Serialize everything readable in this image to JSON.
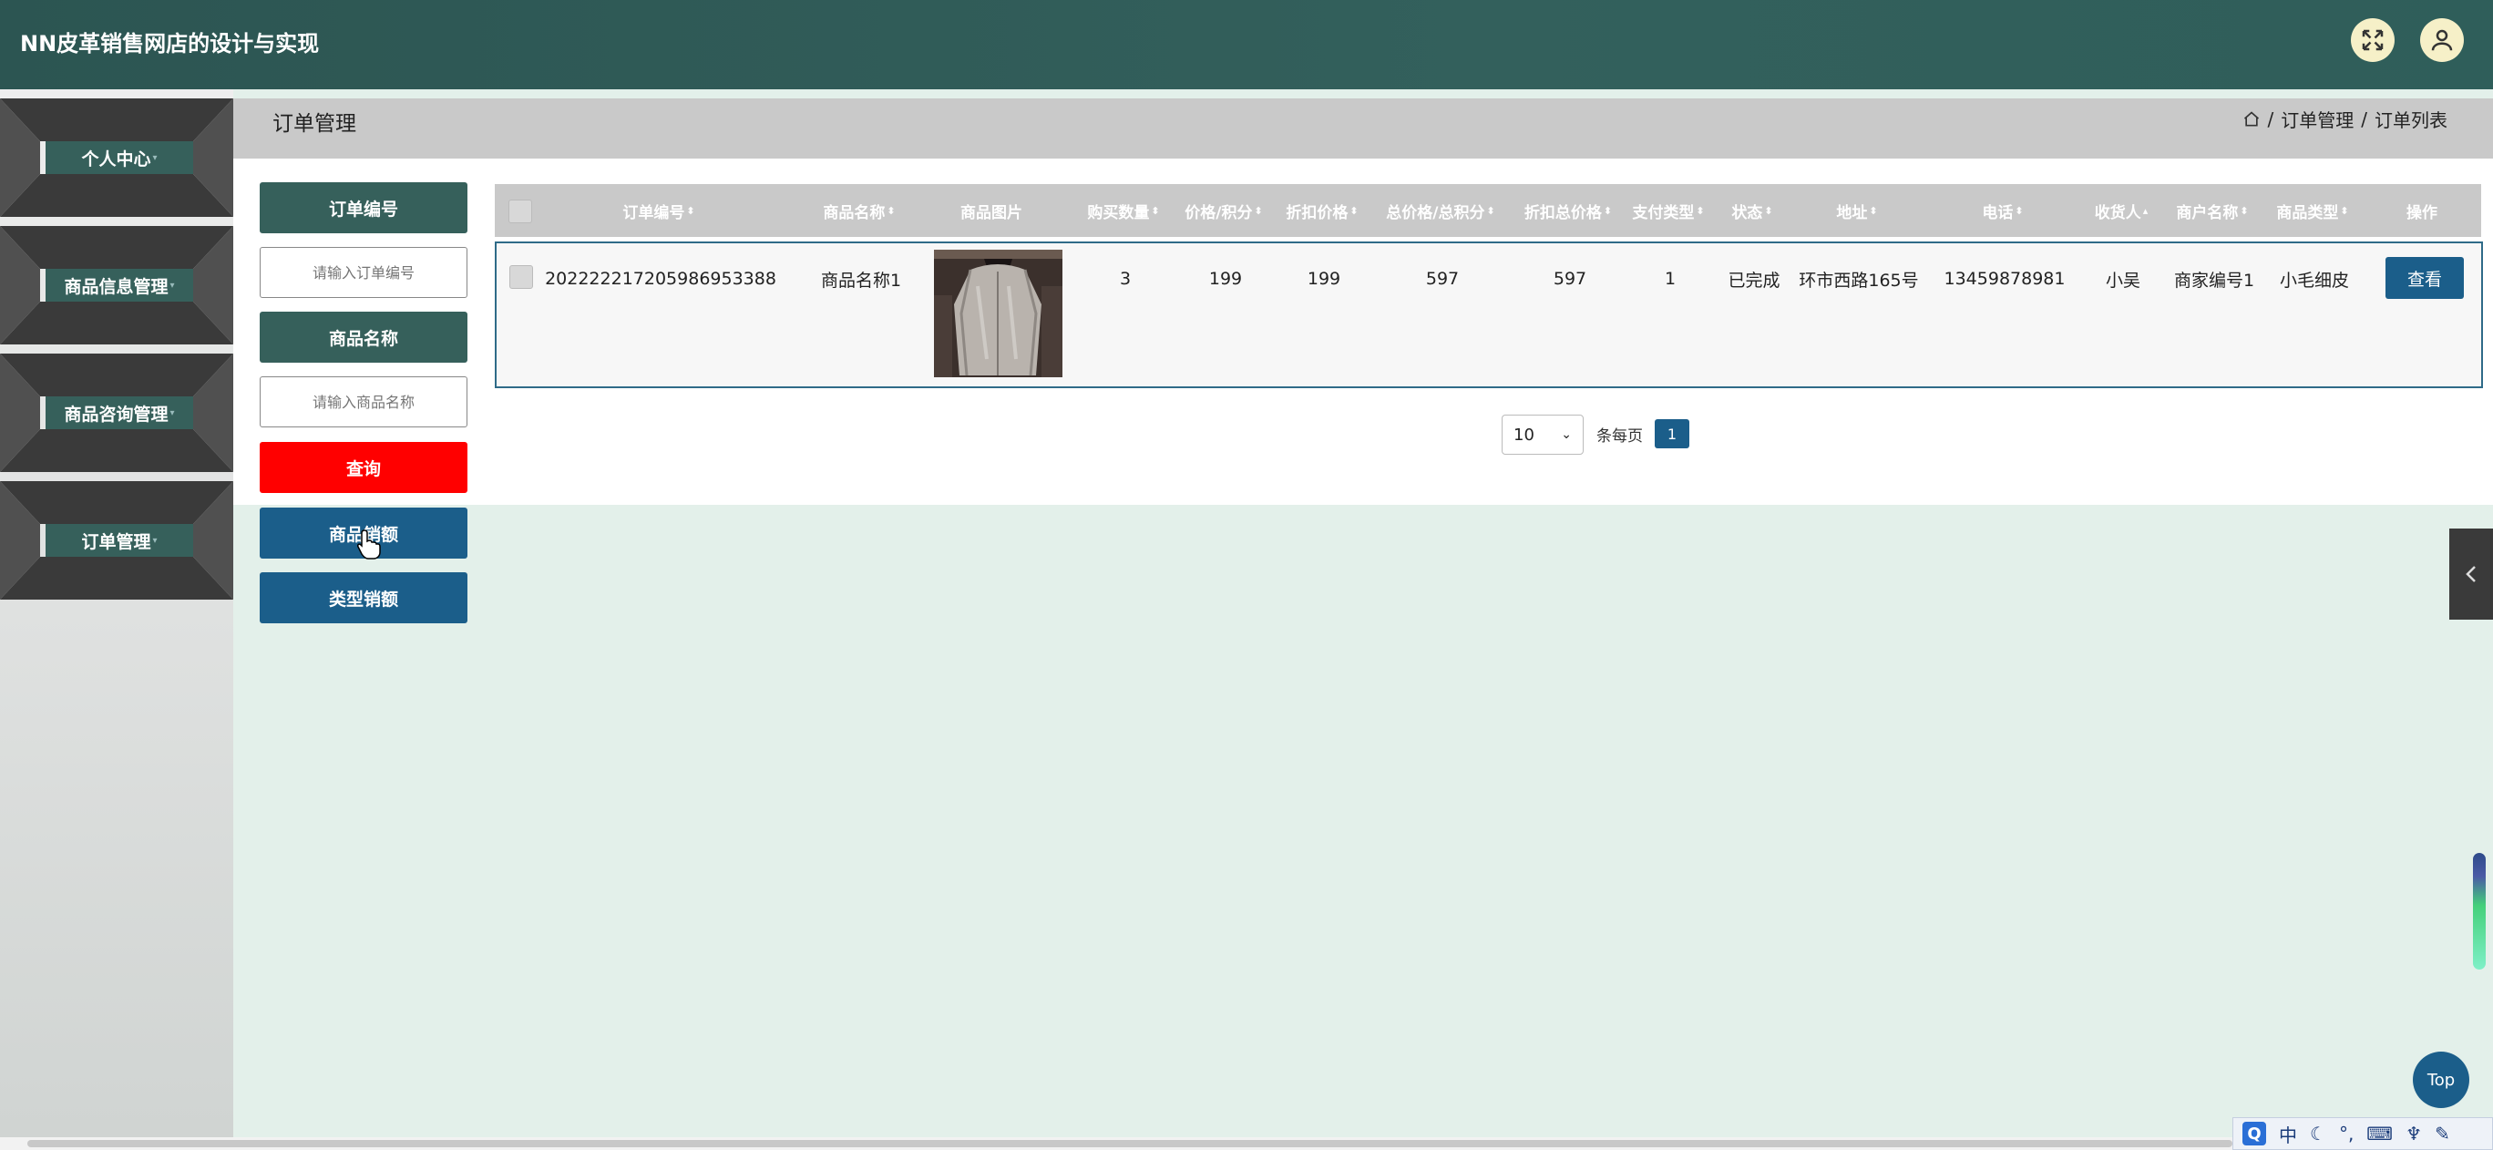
{
  "app": {
    "title": "NN皮革销售网店的设计与实现"
  },
  "sidebar": {
    "items": [
      {
        "label": "个人中心"
      },
      {
        "label": "商品信息管理"
      },
      {
        "label": "商品咨询管理"
      },
      {
        "label": "订单管理"
      }
    ]
  },
  "header": {
    "page_title": "订单管理",
    "breadcrumb": [
      "订单管理",
      "订单列表"
    ],
    "breadcrumb_sep": "/"
  },
  "filters": {
    "order_no_label": "订单编号",
    "order_no_placeholder": "请输入订单编号",
    "product_name_label": "商品名称",
    "product_name_placeholder": "请输入商品名称",
    "query_button": "查询",
    "product_sales_button": "商品销额",
    "type_sales_button": "类型销额"
  },
  "table": {
    "columns": [
      "订单编号",
      "商品名称",
      "商品图片",
      "购买数量",
      "价格/积分",
      "折扣价格",
      "总价格/总积分",
      "折扣总价格",
      "支付类型",
      "状态",
      "地址",
      "电话",
      "收货人",
      "商户名称",
      "商品类型",
      "操作"
    ],
    "rows": [
      {
        "order_no": "20222221720598695338 8",
        "product_name": "商品名称1",
        "quantity": "3",
        "price": "199",
        "discount_price": "199",
        "total_price": "597",
        "discount_total": "597",
        "pay_type": "1",
        "status": "已完成",
        "address": "环市西路165号",
        "phone": "13459878981",
        "receiver": "小吴",
        "merchant": "商家编号1",
        "product_type": "小毛细皮",
        "action": "查看"
      }
    ]
  },
  "pagination": {
    "page_size": "10",
    "per_page_label": "条每页",
    "current_page": "1"
  },
  "misc": {
    "top_button": "Top",
    "ime_lang": "中"
  },
  "colors": {
    "topbar": "#2f5e5a",
    "nav_label": "#36605b",
    "accent_blue": "#1b5e8a",
    "query_red": "#ff0000",
    "content_bg": "#e3f0ea"
  }
}
